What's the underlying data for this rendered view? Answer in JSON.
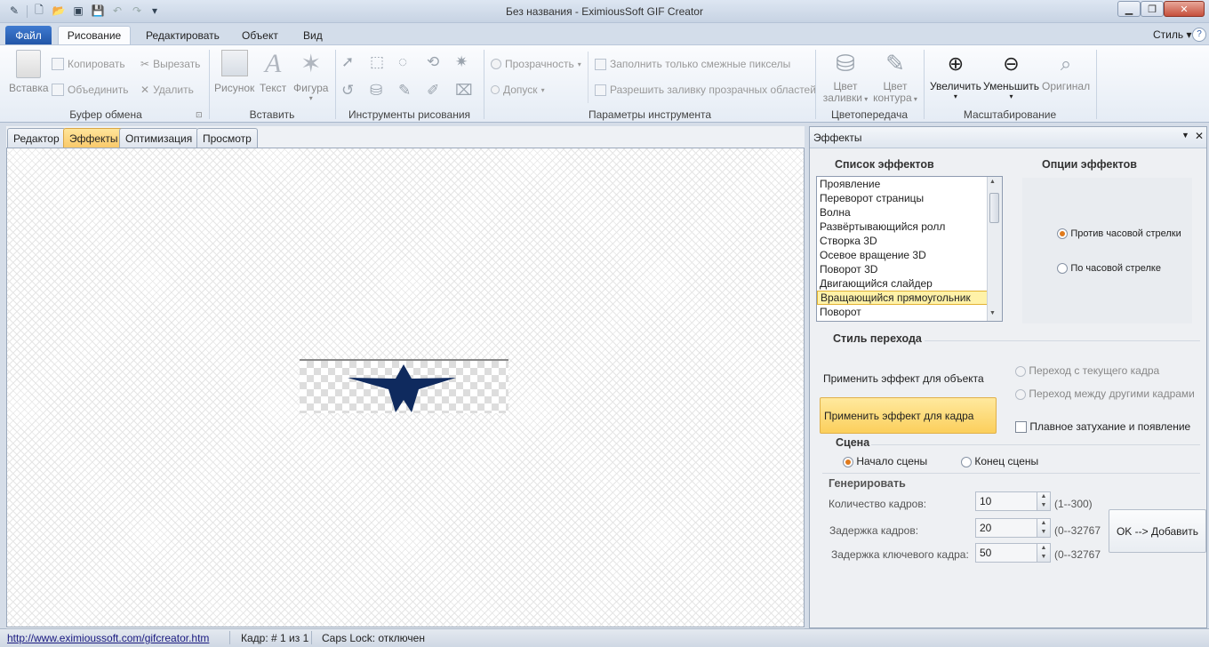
{
  "window": {
    "title": "Без названия - EximiousSoft GIF Creator",
    "controls": [
      "minimize",
      "maximize",
      "close"
    ]
  },
  "ribbon": {
    "file_label": "Файл",
    "tabs": [
      "Рисование",
      "Редактировать",
      "Объект",
      "Вид"
    ],
    "style_label": "Стиль ▾",
    "clipboard": {
      "paste": "Вставка",
      "copy": "Копировать",
      "merge": "Объединить",
      "cut": "Вырезать",
      "delete": "Удалить",
      "group": "Буфер обмена"
    },
    "insert": {
      "picture": "Рисунок",
      "text": "Текст",
      "shape": "Фигура",
      "group": "Вставить"
    },
    "draw_tools": {
      "group": "Инструменты рисования"
    },
    "tool_params": {
      "transparency": "Прозрачность",
      "tolerance": "Допуск",
      "fill_adjacent": "Заполнить только смежные пикселы",
      "allow_transparent": "Разрешить заливку прозрачных областей",
      "group": "Параметры инструмента"
    },
    "color": {
      "fill": [
        "Цвет",
        "заливки"
      ],
      "stroke": [
        "Цвет",
        "контура"
      ],
      "group": "Цветопередача"
    },
    "zoom": {
      "in": "Увеличить",
      "out": "Уменьшить",
      "original": "Оригинал",
      "group": "Масштабирование"
    }
  },
  "doc_tabs": [
    "Редактор",
    "Эффекты",
    "Оптимизация",
    "Просмотр"
  ],
  "active_doc_tab": "Эффекты",
  "panel": {
    "title": "Эффекты",
    "effects_list_header": "Список эффектов",
    "effects_options_header": "Опции эффектов",
    "effects": [
      "Проявление",
      "Переворот страницы",
      "Волна",
      "Развёртывающийся ролл",
      "Створка 3D",
      "Осевое вращение 3D",
      "Поворот 3D",
      "Двигающийся слайдер",
      "Вращающийся прямоугольник",
      "Поворот"
    ],
    "selected_effect": "Вращающийся прямоугольник",
    "options": {
      "ccw": "Против часовой стрелки",
      "cw": "По часовой стрелке",
      "selected": "ccw"
    },
    "transition_header": "Стиль перехода",
    "apply_object": "Применить эффект для объекта",
    "apply_frame": "Применить эффект для кадра",
    "from_current": "Переход с текущего кадра",
    "between_frames": "Переход между другими кадрами",
    "fade": "Плавное затухание и появление",
    "scene_header": "Сцена",
    "scene_start": "Начало сцены",
    "scene_end": "Конец сцены",
    "generate_header": "Генерировать",
    "frame_count_label": "Количество кадров:",
    "frame_count": "10",
    "frame_count_range": "(1--300)",
    "frame_delay_label": "Задержка кадров:",
    "frame_delay": "20",
    "frame_delay_range": "(0--32767",
    "key_delay_label": "Задержка ключевого кадра:",
    "key_delay": "50",
    "key_delay_range": "(0--32767",
    "ok_button": "OK --> Добавить"
  },
  "status": {
    "url": "http://www.eximioussoft.com/gifcreator.htm",
    "frame": "Кадр: # 1 из 1",
    "caps": "Caps Lock: отключен"
  },
  "colors": {
    "accent_tab": "#f9c96a",
    "star": "#0f2a5e",
    "file_tab": "#2c63b9"
  }
}
